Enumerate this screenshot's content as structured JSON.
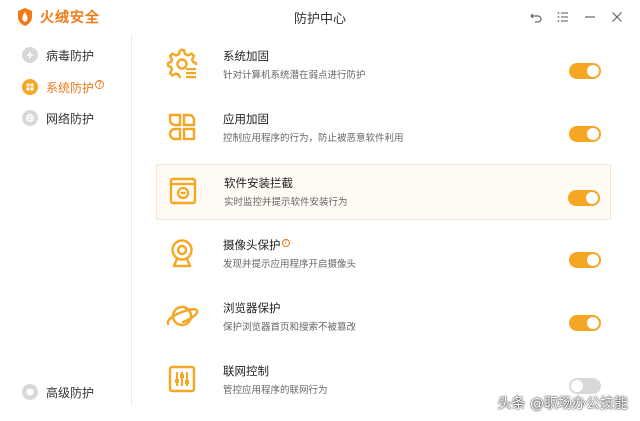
{
  "app": {
    "brand_name": "火绒安全",
    "window_title": "防护中心",
    "accent_color": "#f5a623",
    "brand_color": "#f07a18"
  },
  "window_controls": [
    {
      "icon": "undo-arrow-icon"
    },
    {
      "icon": "menu-list-icon"
    },
    {
      "icon": "minimize-icon"
    },
    {
      "icon": "close-icon"
    }
  ],
  "sidebar": {
    "items": [
      {
        "label": "病毒防护",
        "icon": "shield-plus-icon",
        "active": false
      },
      {
        "label": "系统防护",
        "icon": "windows-icon",
        "active": true,
        "badge": "?"
      },
      {
        "label": "网络防护",
        "icon": "globe-icon",
        "active": false
      }
    ],
    "bottom_item": {
      "label": "高级防护",
      "icon": "advanced-shield-icon"
    }
  },
  "features": [
    {
      "title": "系统加固",
      "desc": "针对计算机系统潜在弱点进行防护",
      "icon": "gear-shield-icon",
      "enabled": true
    },
    {
      "title": "应用加固",
      "desc": "控制应用程序的行为，防止被恶意软件利用",
      "icon": "app-grid-icon",
      "enabled": true
    },
    {
      "title": "软件安装拦截",
      "desc": "实时监控并提示软件安装行为",
      "icon": "install-block-icon",
      "enabled": true
    },
    {
      "title": "摄像头保护",
      "desc": "发现并提示应用程序开启摄像头",
      "icon": "webcam-icon",
      "enabled": true,
      "badge": "?"
    },
    {
      "title": "浏览器保护",
      "desc": "保护浏览器首页和搜索不被篡改",
      "icon": "browser-planet-icon",
      "enabled": true
    },
    {
      "title": "联网控制",
      "desc": "管控应用程序的联网行为",
      "icon": "network-sliders-icon",
      "enabled": false
    }
  ],
  "watermark": "头条 @职场办公技能"
}
